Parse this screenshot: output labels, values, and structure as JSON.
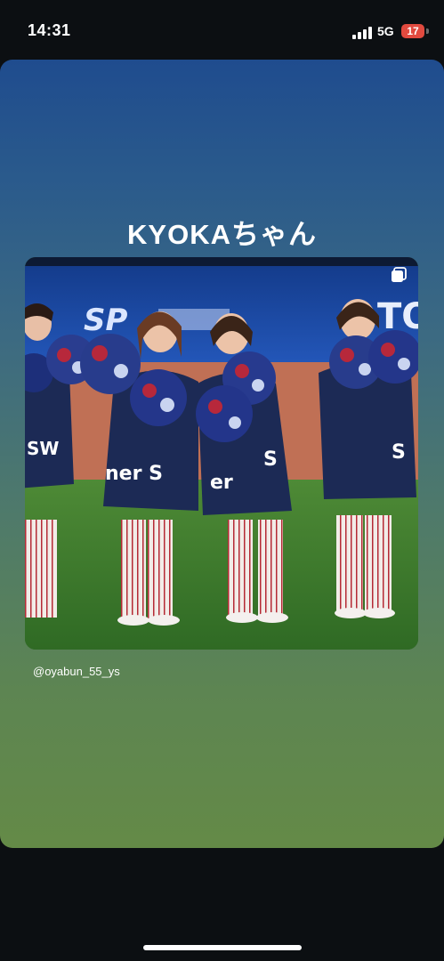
{
  "status_bar": {
    "time": "14:31",
    "network": "5G",
    "battery": "17",
    "battery_color": "#e14a3f"
  },
  "story": {
    "title": "KYOKAちゃん",
    "gradient_top": "#1f4c8e",
    "gradient_bottom": "#648a47",
    "post": {
      "username": "@oyabun_55_ys",
      "carousel_icon": "carousel-stack-icon",
      "photo": {
        "description_icon": "photo",
        "background_signage_fragments": [
          "SP",
          "TO"
        ],
        "uniform_text": [
          "SW",
          "ner S",
          "S",
          "er",
          "S"
        ]
      }
    }
  },
  "colors": {
    "background": "#0c0f12",
    "field_green": "#3f7a2c",
    "dirt": "#c07055",
    "wall_blue": "#1e4fa6",
    "uniform_navy": "#1c2a55"
  }
}
